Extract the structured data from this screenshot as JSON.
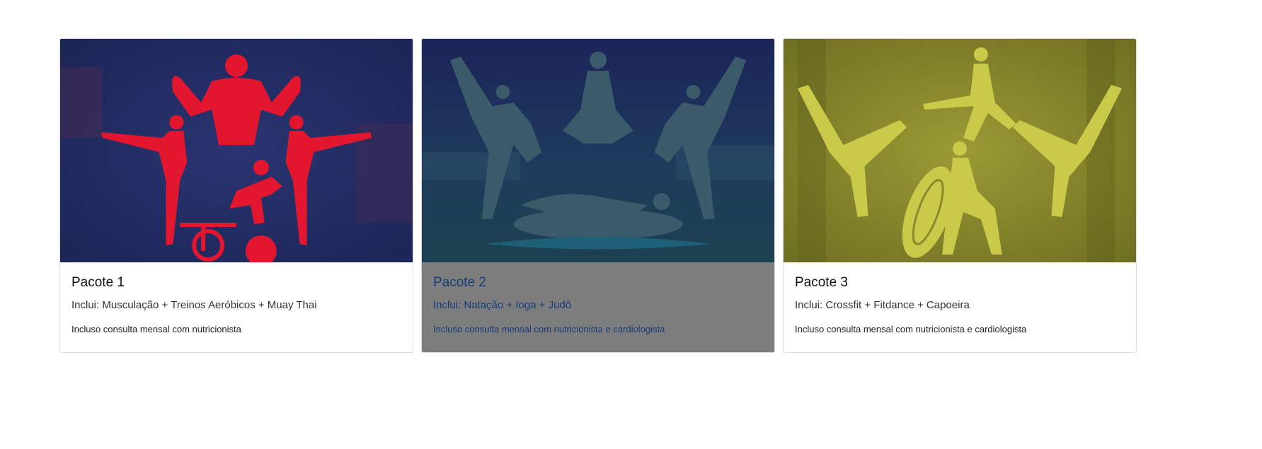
{
  "colors": {
    "navy_bg": "#1c2557",
    "red_figure": "#e3162f",
    "teal_figure": "#3b5a6a",
    "olive_bg": "#8a8a2c",
    "yellow_figure": "#c9c94a",
    "active_overlay": "#7d7d7d",
    "active_text": "#163d7a"
  },
  "cards": [
    {
      "title": "Pacote 1",
      "includes": "Inclui: Musculação + Treinos Aeróbicos + Muay Thai",
      "note": "Incluso consulta mensal com nutricionista",
      "image_icon": "fitness-silhouettes-icon",
      "active": false
    },
    {
      "title": "Pacote 2",
      "includes": "Inclui: Natação + Ioga + Judô",
      "note": "Incluso consulta mensal com nutricionista e cardiologista",
      "image_icon": "martial-arts-yoga-swim-icon",
      "active": true
    },
    {
      "title": "Pacote 3",
      "includes": "Inclui: Crossfit + Fitdance + Capoeira",
      "note": "Incluso consulta mensal com nutricionista e cardiologista",
      "image_icon": "crossfit-dance-capoeira-icon",
      "active": false
    }
  ]
}
